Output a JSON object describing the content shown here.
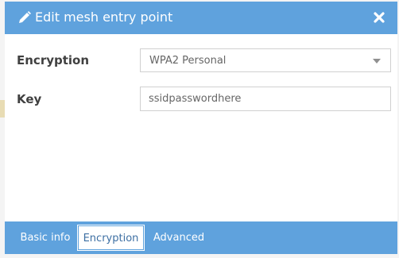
{
  "dialog": {
    "title": "Edit mesh entry point",
    "header_icon": "pencil-icon",
    "close_icon": "close-icon",
    "accent_color": "#5fa2dd"
  },
  "form": {
    "encryption_label": "Encryption",
    "encryption_value": "WPA2 Personal",
    "key_label": "Key",
    "key_value": "ssidpasswordhere"
  },
  "tabs": [
    {
      "label": "Basic info",
      "active": false
    },
    {
      "label": "Encryption",
      "active": true
    },
    {
      "label": "Advanced",
      "active": false
    }
  ]
}
